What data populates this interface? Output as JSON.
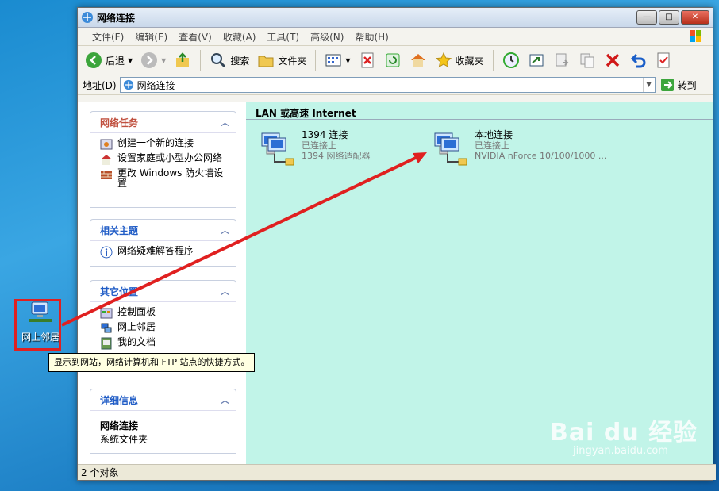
{
  "desktop": {
    "icon_label": "网上邻居"
  },
  "tooltip": {
    "text": "显示到网站，网络计算机和 FTP 站点的快捷方式。"
  },
  "window": {
    "title": "网络连接",
    "controls": {
      "minimize": "0",
      "maximize": "1",
      "close": "r"
    },
    "menu": [
      "文件(F)",
      "编辑(E)",
      "查看(V)",
      "收藏(A)",
      "工具(T)",
      "高级(N)",
      "帮助(H)"
    ],
    "toolbar": {
      "back": "后退",
      "search": "搜索",
      "folders": "文件夹",
      "favorites": "收藏夹"
    },
    "address": {
      "label": "地址(D)",
      "value": "网络连接",
      "go": "转到"
    },
    "left_panes": [
      {
        "title": "网络任务",
        "items": [
          "创建一个新的连接",
          "设置家庭或小型办公网络",
          "更改 Windows 防火墙设置"
        ]
      },
      {
        "title": "相关主题",
        "items": [
          "网络疑难解答程序"
        ]
      },
      {
        "title": "其它位置",
        "items": [
          "控制面板",
          "网上邻居",
          "我的文档"
        ]
      },
      {
        "title": "详细信息",
        "detail_title": "网络连接",
        "detail_sub": "系统文件夹"
      }
    ],
    "content": {
      "section": "LAN 或高速 Internet",
      "connections": [
        {
          "name": "1394 连接",
          "status": "已连接上",
          "device": "1394 网络适配器"
        },
        {
          "name": "本地连接",
          "status": "已连接上",
          "device": "NVIDIA nForce 10/100/1000 ..."
        }
      ]
    },
    "status": "2 个对象"
  },
  "watermark": {
    "brand": "Bai du 经验",
    "url": "jingyan.baidu.com"
  },
  "colors": {
    "desktop": "#2a96d8",
    "content_bg": "#c1f4e8",
    "annotation": "#e02020",
    "pane_title_red": "#c0503f",
    "pane_title_blue": "#215dc6"
  }
}
